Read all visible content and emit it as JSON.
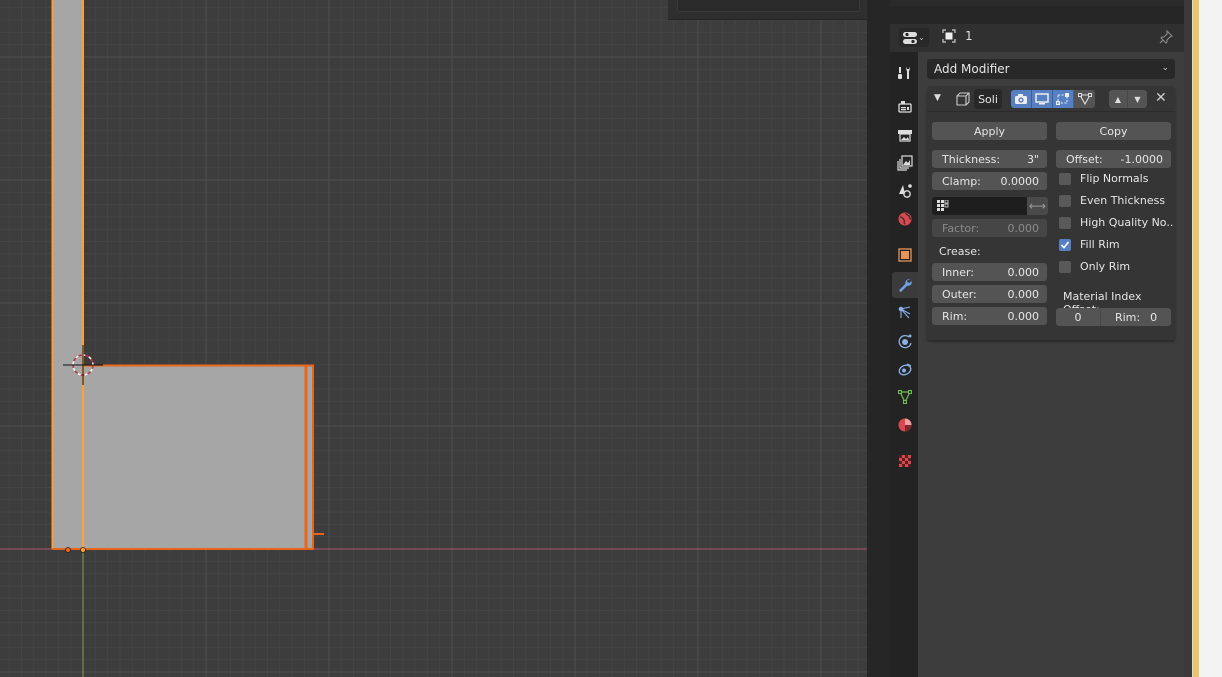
{
  "app": "Blender",
  "viewport": {
    "description": "3D viewport, orthographic side view with selected solidified object",
    "colors": {
      "background": "#3d3d3d",
      "grid_minor": "#444444",
      "grid_major": "#4f4f4f",
      "x_axis": "#b0546a",
      "y_axis": "#7fa33a",
      "mesh_fill": "#a5a6a5",
      "selection_active": "#ffa033",
      "selection": "#e8651c"
    },
    "cursor_icon": "3d-cursor-icon"
  },
  "properties": {
    "header": {
      "editor_icon": "editor-type-icon",
      "object_icon": "object-data-icon",
      "object_name": "1",
      "pin_icon": "pin-icon"
    },
    "tabs": [
      {
        "name": "tool",
        "icon": "tool-icon",
        "active": false
      },
      {
        "name": "render",
        "icon": "render-icon",
        "active": false
      },
      {
        "name": "output",
        "icon": "output-icon",
        "active": false
      },
      {
        "name": "view-layer",
        "icon": "view-layer-icon",
        "active": false
      },
      {
        "name": "scene",
        "icon": "scene-icon",
        "active": false
      },
      {
        "name": "world",
        "icon": "world-icon",
        "active": false
      },
      {
        "name": "object",
        "icon": "object-icon",
        "active": false
      },
      {
        "name": "modifiers",
        "icon": "wrench-icon",
        "active": true
      },
      {
        "name": "particles",
        "icon": "particles-icon",
        "active": false
      },
      {
        "name": "physics",
        "icon": "physics-icon",
        "active": false
      },
      {
        "name": "constraints",
        "icon": "constraints-icon",
        "active": false
      },
      {
        "name": "data",
        "icon": "mesh-data-icon",
        "active": false
      },
      {
        "name": "material",
        "icon": "material-icon",
        "active": false
      },
      {
        "name": "texture",
        "icon": "texture-icon",
        "active": false
      }
    ],
    "add_modifier_label": "Add Modifier",
    "modifier": {
      "name": "Soli",
      "expanded": true,
      "show_render": true,
      "show_viewport": true,
      "show_editmode": true,
      "show_on_cage": false,
      "apply_label": "Apply",
      "copy_label": "Copy",
      "thickness_label": "Thickness:",
      "thickness_value": "3\"",
      "offset_label": "Offset:",
      "offset_value": "-1.0000",
      "clamp_label": "Clamp:",
      "clamp_value": "0.0000",
      "vertex_group_value": "",
      "factor_label": "Factor:",
      "factor_value": "0.000",
      "crease_label": "Crease:",
      "inner_label": "Inner:",
      "inner_value": "0.000",
      "outer_label": "Outer:",
      "outer_value": "0.000",
      "rim_label": "Rim:",
      "rim_value": "0.000",
      "checkboxes": [
        {
          "label": "Flip Normals",
          "checked": false
        },
        {
          "label": "Even Thickness",
          "checked": false
        },
        {
          "label": "High Quality No..",
          "checked": false
        },
        {
          "label": "Fill Rim",
          "checked": true
        },
        {
          "label": "Only Rim",
          "checked": false
        }
      ],
      "material_index_offset_label": "Material Index Offset:",
      "material_offset_value": "0",
      "material_rim_label": "Rim:",
      "material_rim_value": "0"
    },
    "accent_color": "#5680c2"
  }
}
